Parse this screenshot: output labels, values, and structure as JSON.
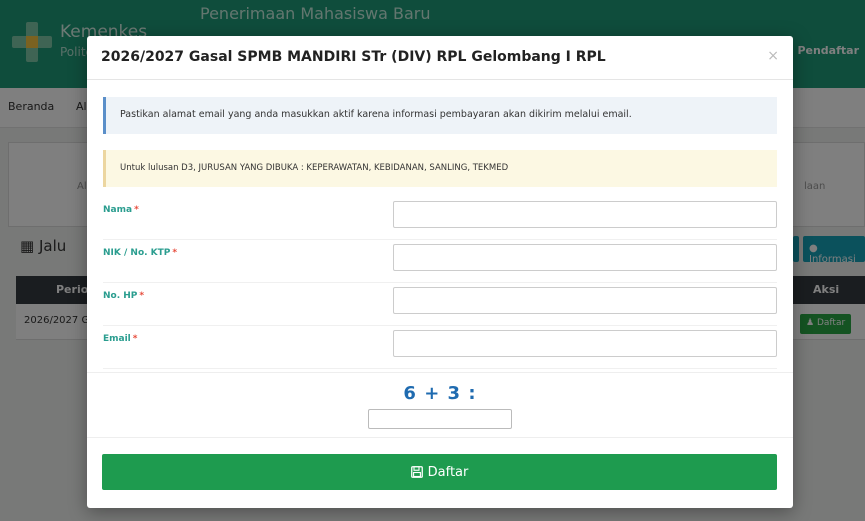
{
  "background": {
    "brand_title": "Kemenkes",
    "brand_sub": "Politeknik",
    "site_title": "Penerimaan Mahasiswa Baru",
    "login_label": "Login Pendaftar",
    "nav_items": [
      "Beranda",
      "Al"
    ],
    "step_left": "Al",
    "step_right": "laan",
    "jalur_label": "Jalu",
    "info_button": "Informasi",
    "table_headers": [
      "Period",
      "Aksi"
    ],
    "row_period": "2026/2027 G",
    "row_action": "Daftar"
  },
  "modal": {
    "title": "2026/2027 Gasal SPMB MANDIRI STr (DIV) RPL Gelombang I RPL",
    "close_label": "×",
    "alert_info": "Pastikan alamat email yang anda masukkan aktif karena informasi pembayaran akan dikirim melalui email.",
    "alert_warn": "Untuk lulusan D3, JURUSAN YANG DIBUKA : KEPERAWATAN, KEBIDANAN, SANLING, TEKMED",
    "fields": [
      {
        "label": "Nama",
        "required": "*",
        "value": ""
      },
      {
        "label": "NIK / No. KTP",
        "required": "*",
        "value": ""
      },
      {
        "label": "No. HP",
        "required": "*",
        "value": ""
      },
      {
        "label": "Email",
        "required": "*",
        "value": ""
      }
    ],
    "captcha_question": "6 + 3 :",
    "captcha_value": "",
    "submit_label": "Daftar"
  },
  "icons": {
    "calendar": "calendar-icon",
    "save": "save-icon",
    "info": "info-icon",
    "user": "user-icon"
  },
  "colors": {
    "header_green": "#1e9b78",
    "label_teal": "#2a9d8f",
    "required_red": "#e74c3c",
    "captcha_blue": "#1f6bb0",
    "submit_green": "#1e9b4f"
  }
}
